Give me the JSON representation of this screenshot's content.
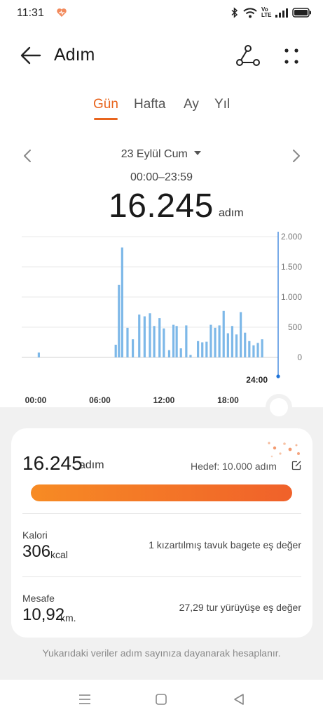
{
  "status_bar": {
    "time": "11:31",
    "network_label": "Vo LTE",
    "icons": [
      "heart-icon",
      "bluetooth-icon",
      "wifi-icon",
      "volte-icon",
      "signal-icon",
      "battery-icon"
    ]
  },
  "header": {
    "title": "Adım",
    "icons": [
      "back-arrow-icon",
      "share-icon",
      "more-dots-icon"
    ]
  },
  "tabs": [
    {
      "label": "Gün",
      "active": true
    },
    {
      "label": "Hafta",
      "active": false
    },
    {
      "label": "Ay",
      "active": false
    },
    {
      "label": "Yıl",
      "active": false
    }
  ],
  "date_nav": {
    "date": "23 Eylül Cum",
    "time_range": "00:00–23:59"
  },
  "summary": {
    "steps": "16.245",
    "unit": "adım"
  },
  "chart_data": {
    "type": "bar",
    "x_tick_labels": [
      "00:00",
      "06:00",
      "12:00",
      "18:00"
    ],
    "y_tick_labels": [
      "2.000",
      "1.500",
      "1.000",
      "500",
      "0"
    ],
    "ylim": [
      0,
      2000
    ],
    "grid": true,
    "cursor_label": "24:00",
    "bar_color": "#7db8e8",
    "cursor_color": "#1e73d8",
    "points": [
      {
        "hour": 1.6,
        "steps": 80
      },
      {
        "hour": 8.8,
        "steps": 210
      },
      {
        "hour": 9.1,
        "steps": 1200
      },
      {
        "hour": 9.4,
        "steps": 1820
      },
      {
        "hour": 9.9,
        "steps": 490
      },
      {
        "hour": 10.4,
        "steps": 300
      },
      {
        "hour": 11.0,
        "steps": 710
      },
      {
        "hour": 11.5,
        "steps": 680
      },
      {
        "hour": 12.0,
        "steps": 730
      },
      {
        "hour": 12.4,
        "steps": 520
      },
      {
        "hour": 12.9,
        "steps": 650
      },
      {
        "hour": 13.3,
        "steps": 480
      },
      {
        "hour": 13.8,
        "steps": 120
      },
      {
        "hour": 14.2,
        "steps": 540
      },
      {
        "hour": 14.5,
        "steps": 520
      },
      {
        "hour": 14.9,
        "steps": 150
      },
      {
        "hour": 15.4,
        "steps": 530
      },
      {
        "hour": 15.8,
        "steps": 40
      },
      {
        "hour": 16.5,
        "steps": 270
      },
      {
        "hour": 16.9,
        "steps": 250
      },
      {
        "hour": 17.3,
        "steps": 260
      },
      {
        "hour": 17.7,
        "steps": 540
      },
      {
        "hour": 18.1,
        "steps": 490
      },
      {
        "hour": 18.5,
        "steps": 530
      },
      {
        "hour": 18.9,
        "steps": 770
      },
      {
        "hour": 19.3,
        "steps": 400
      },
      {
        "hour": 19.7,
        "steps": 520
      },
      {
        "hour": 20.1,
        "steps": 380
      },
      {
        "hour": 20.5,
        "steps": 750
      },
      {
        "hour": 20.9,
        "steps": 410
      },
      {
        "hour": 21.3,
        "steps": 270
      },
      {
        "hour": 21.7,
        "steps": 200
      },
      {
        "hour": 22.1,
        "steps": 240
      },
      {
        "hour": 22.5,
        "steps": 300
      }
    ]
  },
  "stats_card": {
    "steps": "16.245",
    "steps_unit": "adım",
    "goal_text": "Hedef: 10.000 adım",
    "progress": 1.0,
    "calories": {
      "label": "Kalori",
      "value": "306",
      "unit": "kcal",
      "equivalent": "1 kızartılmış tavuk bagete eş değer"
    },
    "distance": {
      "label": "Mesafe",
      "value": "10,92",
      "unit": "km.",
      "equivalent": "27,29 tur yürüyüşe eş değer"
    }
  },
  "footnote": "Yukarıdaki veriler adım sayınıza dayanarak hesaplanır.",
  "nav_bar": {
    "icons": [
      "recents-menu-icon",
      "home-square-icon",
      "back-triangle-icon"
    ]
  },
  "colors": {
    "accent": "#e8651e",
    "progress_start": "#f78b24",
    "progress_end": "#f0612a",
    "sheet_background": "#f1f1f1"
  }
}
